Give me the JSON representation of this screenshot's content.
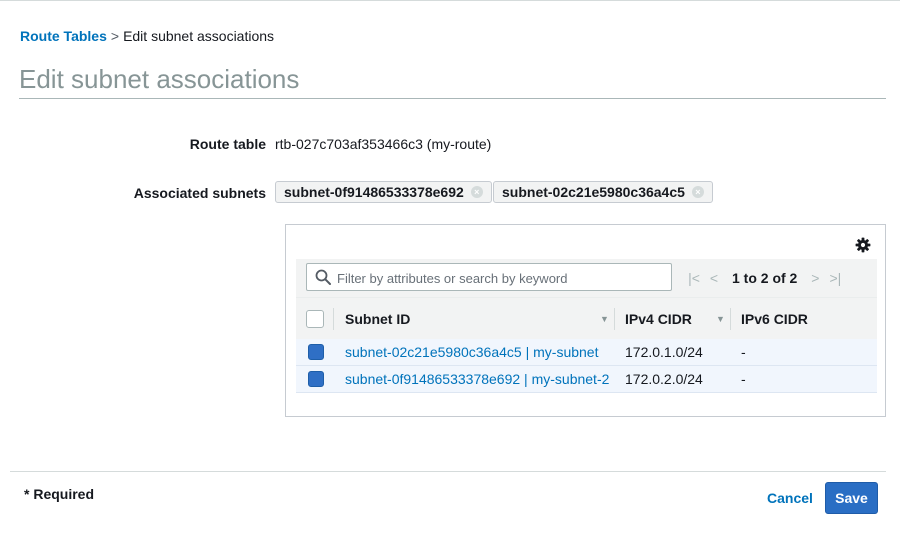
{
  "breadcrumb": {
    "parent": "Route Tables",
    "separator": ">",
    "current": "Edit subnet associations"
  },
  "page_title": "Edit subnet associations",
  "form": {
    "route_table_label": "Route table",
    "route_table_value": "rtb-027c703af353466c3 (my-route)",
    "associated_subnets_label": "Associated subnets",
    "associated_tokens": [
      "subnet-0f91486533378e692",
      "subnet-02c21e5980c36a4c5"
    ]
  },
  "table": {
    "search_placeholder": "Filter by attributes or search by keyword",
    "pagination": "1 to 2 of 2",
    "columns": {
      "subnet_id": "Subnet ID",
      "ipv4": "IPv4 CIDR",
      "ipv6": "IPv6 CIDR"
    },
    "rows": [
      {
        "subnet": "subnet-02c21e5980c36a4c5 | my-subnet",
        "ipv4": "172.0.1.0/24",
        "ipv6": "-",
        "selected": true
      },
      {
        "subnet": "subnet-0f91486533378e692 | my-subnet-2",
        "ipv4": "172.0.2.0/24",
        "ipv6": "-",
        "selected": true
      }
    ]
  },
  "footer": {
    "required_note": "* Required",
    "cancel_label": "Cancel",
    "save_label": "Save"
  },
  "colors": {
    "link": "#0073bb",
    "primary_button": "#2a6ec4",
    "selected_row": "#f1f6fd"
  },
  "icons": {
    "settings": "gear-icon",
    "search": "search-icon",
    "remove": "close-icon"
  }
}
